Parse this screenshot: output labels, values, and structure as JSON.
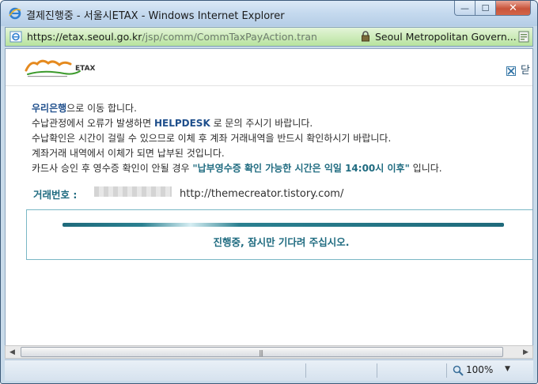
{
  "window": {
    "title": "결제진행중 - 서울시ETAX - Windows Internet Explorer",
    "min_label": "—",
    "max_label": "☐",
    "close_label": "✕"
  },
  "address": {
    "url_prefix": "https://etax.",
    "url_host": "seoul.go.kr",
    "url_rest": "/jsp/comm/CommTaxPayAction.tran",
    "site_name": "Seoul Metropolitan Govern..."
  },
  "header": {
    "logo_brand": "ETAX",
    "close_label": "닫"
  },
  "message": {
    "line1_bank": "우리은행",
    "line1_rest": "으로 이동 합니다.",
    "line2_a": "수납관정에서 오류가 발생하면 ",
    "line2_helpdesk": "HELPDESK",
    "line2_b": " 로 문의 주시기 바랍니다.",
    "line3": "수납확인은 시간이 걸릴 수 있으므로 이체 후 계좌 거래내역을 반드시 확인하시기 바랍니다.",
    "line4": "계좌거래 내역에서 이체가 되면 납부된 것입니다.",
    "line5_a": "카드사 승인 후 영수증 확인이 안될 경우 ",
    "line5_b": "\"납부영수증 확인 가능한 시간은 익일 14:00시 이후\"",
    "line5_c": " 입니다."
  },
  "transaction": {
    "label": "거래번호 :",
    "watermark": "http://themecreator.tistory.com/"
  },
  "progress": {
    "text": "진행중, 잠시만 기다려 주십시오."
  },
  "scrollbar": {
    "left_arrow": "◀",
    "right_arrow": "▶",
    "grip": "|||"
  },
  "status": {
    "zoom": "100%",
    "zoom_arrow": "▼"
  }
}
